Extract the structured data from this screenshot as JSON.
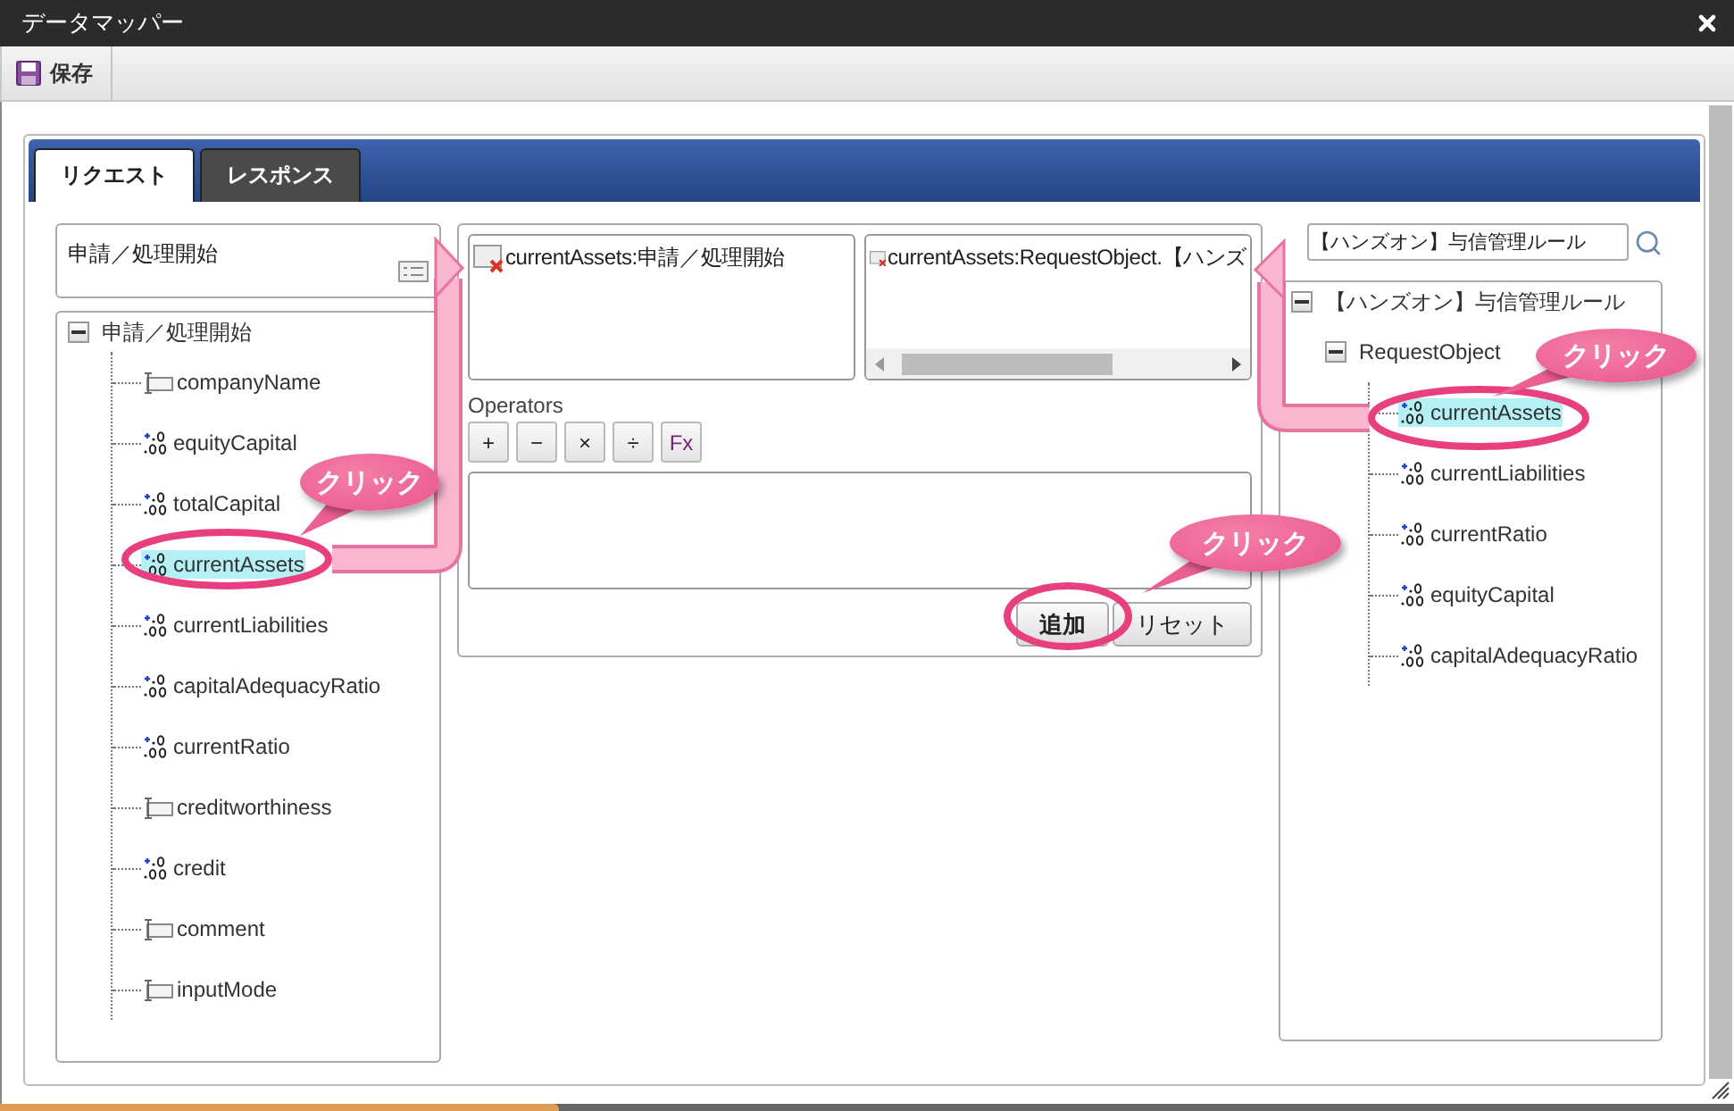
{
  "window": {
    "title": "データマッパー"
  },
  "toolbar": {
    "save_button": "保存"
  },
  "tabs": [
    {
      "label": "リクエスト",
      "selected": true
    },
    {
      "label": "レスポンス",
      "selected": false
    }
  ],
  "source": {
    "field": "申請／処理開始",
    "tree": {
      "label": "申請／処理開始",
      "expanded": true,
      "selected": false,
      "children": [
        {
          "label": "companyName",
          "kind": "string",
          "selected": false
        },
        {
          "label": "equityCapital",
          "kind": "number",
          "selected": false
        },
        {
          "label": "totalCapital",
          "kind": "number",
          "selected": false
        },
        {
          "label": "currentAssets",
          "kind": "number",
          "selected": true
        },
        {
          "label": "currentLiabilities",
          "kind": "number",
          "selected": false
        },
        {
          "label": "capitalAdequacyRatio",
          "kind": "number",
          "selected": false
        },
        {
          "label": "currentRatio",
          "kind": "number",
          "selected": false
        },
        {
          "label": "creditworthiness",
          "kind": "string",
          "selected": false
        },
        {
          "label": "credit",
          "kind": "number",
          "selected": false
        },
        {
          "label": "comment",
          "kind": "string",
          "selected": false
        },
        {
          "label": "inputMode",
          "kind": "string",
          "selected": false
        }
      ]
    }
  },
  "mapping": {
    "source_item": "currentAssets:申請／処理開始",
    "target_item": "currentAssets:RequestObject.【ハンズ",
    "operators_label": "Operators",
    "operators": [
      "+",
      "−",
      "×",
      "÷",
      "Fx"
    ],
    "buttons": [
      {
        "label": "追加"
      },
      {
        "label": "リセット"
      }
    ]
  },
  "target": {
    "search": "【ハンズオン】与信管理ルール",
    "tree": {
      "label": "【ハンズオン】与信管理ルール",
      "expanded": true,
      "selected": false,
      "children": [
        {
          "label": "RequestObject",
          "kind": "object",
          "expanded": true,
          "selected": false,
          "children": [
            {
              "label": "currentAssets",
              "kind": "number",
              "selected": true
            },
            {
              "label": "currentLiabilities",
              "kind": "number",
              "selected": false
            },
            {
              "label": "currentRatio",
              "kind": "number",
              "selected": false
            },
            {
              "label": "equityCapital",
              "kind": "number",
              "selected": false
            },
            {
              "label": "capitalAdequacyRatio",
              "kind": "number",
              "selected": false
            }
          ]
        }
      ]
    }
  },
  "annotations": {
    "callouts": [
      "クリック",
      "クリック",
      "クリック"
    ]
  }
}
